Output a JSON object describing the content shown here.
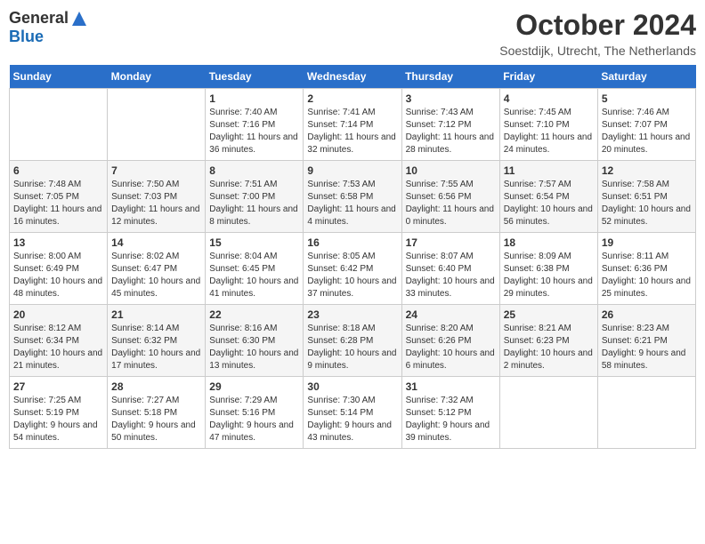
{
  "logo": {
    "general": "General",
    "blue": "Blue"
  },
  "title": "October 2024",
  "location": "Soestdijk, Utrecht, The Netherlands",
  "days_of_week": [
    "Sunday",
    "Monday",
    "Tuesday",
    "Wednesday",
    "Thursday",
    "Friday",
    "Saturday"
  ],
  "weeks": [
    [
      {
        "day": "",
        "info": ""
      },
      {
        "day": "",
        "info": ""
      },
      {
        "day": "1",
        "info": "Sunrise: 7:40 AM\nSunset: 7:16 PM\nDaylight: 11 hours and 36 minutes."
      },
      {
        "day": "2",
        "info": "Sunrise: 7:41 AM\nSunset: 7:14 PM\nDaylight: 11 hours and 32 minutes."
      },
      {
        "day": "3",
        "info": "Sunrise: 7:43 AM\nSunset: 7:12 PM\nDaylight: 11 hours and 28 minutes."
      },
      {
        "day": "4",
        "info": "Sunrise: 7:45 AM\nSunset: 7:10 PM\nDaylight: 11 hours and 24 minutes."
      },
      {
        "day": "5",
        "info": "Sunrise: 7:46 AM\nSunset: 7:07 PM\nDaylight: 11 hours and 20 minutes."
      }
    ],
    [
      {
        "day": "6",
        "info": "Sunrise: 7:48 AM\nSunset: 7:05 PM\nDaylight: 11 hours and 16 minutes."
      },
      {
        "day": "7",
        "info": "Sunrise: 7:50 AM\nSunset: 7:03 PM\nDaylight: 11 hours and 12 minutes."
      },
      {
        "day": "8",
        "info": "Sunrise: 7:51 AM\nSunset: 7:00 PM\nDaylight: 11 hours and 8 minutes."
      },
      {
        "day": "9",
        "info": "Sunrise: 7:53 AM\nSunset: 6:58 PM\nDaylight: 11 hours and 4 minutes."
      },
      {
        "day": "10",
        "info": "Sunrise: 7:55 AM\nSunset: 6:56 PM\nDaylight: 11 hours and 0 minutes."
      },
      {
        "day": "11",
        "info": "Sunrise: 7:57 AM\nSunset: 6:54 PM\nDaylight: 10 hours and 56 minutes."
      },
      {
        "day": "12",
        "info": "Sunrise: 7:58 AM\nSunset: 6:51 PM\nDaylight: 10 hours and 52 minutes."
      }
    ],
    [
      {
        "day": "13",
        "info": "Sunrise: 8:00 AM\nSunset: 6:49 PM\nDaylight: 10 hours and 48 minutes."
      },
      {
        "day": "14",
        "info": "Sunrise: 8:02 AM\nSunset: 6:47 PM\nDaylight: 10 hours and 45 minutes."
      },
      {
        "day": "15",
        "info": "Sunrise: 8:04 AM\nSunset: 6:45 PM\nDaylight: 10 hours and 41 minutes."
      },
      {
        "day": "16",
        "info": "Sunrise: 8:05 AM\nSunset: 6:42 PM\nDaylight: 10 hours and 37 minutes."
      },
      {
        "day": "17",
        "info": "Sunrise: 8:07 AM\nSunset: 6:40 PM\nDaylight: 10 hours and 33 minutes."
      },
      {
        "day": "18",
        "info": "Sunrise: 8:09 AM\nSunset: 6:38 PM\nDaylight: 10 hours and 29 minutes."
      },
      {
        "day": "19",
        "info": "Sunrise: 8:11 AM\nSunset: 6:36 PM\nDaylight: 10 hours and 25 minutes."
      }
    ],
    [
      {
        "day": "20",
        "info": "Sunrise: 8:12 AM\nSunset: 6:34 PM\nDaylight: 10 hours and 21 minutes."
      },
      {
        "day": "21",
        "info": "Sunrise: 8:14 AM\nSunset: 6:32 PM\nDaylight: 10 hours and 17 minutes."
      },
      {
        "day": "22",
        "info": "Sunrise: 8:16 AM\nSunset: 6:30 PM\nDaylight: 10 hours and 13 minutes."
      },
      {
        "day": "23",
        "info": "Sunrise: 8:18 AM\nSunset: 6:28 PM\nDaylight: 10 hours and 9 minutes."
      },
      {
        "day": "24",
        "info": "Sunrise: 8:20 AM\nSunset: 6:26 PM\nDaylight: 10 hours and 6 minutes."
      },
      {
        "day": "25",
        "info": "Sunrise: 8:21 AM\nSunset: 6:23 PM\nDaylight: 10 hours and 2 minutes."
      },
      {
        "day": "26",
        "info": "Sunrise: 8:23 AM\nSunset: 6:21 PM\nDaylight: 9 hours and 58 minutes."
      }
    ],
    [
      {
        "day": "27",
        "info": "Sunrise: 7:25 AM\nSunset: 5:19 PM\nDaylight: 9 hours and 54 minutes."
      },
      {
        "day": "28",
        "info": "Sunrise: 7:27 AM\nSunset: 5:18 PM\nDaylight: 9 hours and 50 minutes."
      },
      {
        "day": "29",
        "info": "Sunrise: 7:29 AM\nSunset: 5:16 PM\nDaylight: 9 hours and 47 minutes."
      },
      {
        "day": "30",
        "info": "Sunrise: 7:30 AM\nSunset: 5:14 PM\nDaylight: 9 hours and 43 minutes."
      },
      {
        "day": "31",
        "info": "Sunrise: 7:32 AM\nSunset: 5:12 PM\nDaylight: 9 hours and 39 minutes."
      },
      {
        "day": "",
        "info": ""
      },
      {
        "day": "",
        "info": ""
      }
    ]
  ]
}
